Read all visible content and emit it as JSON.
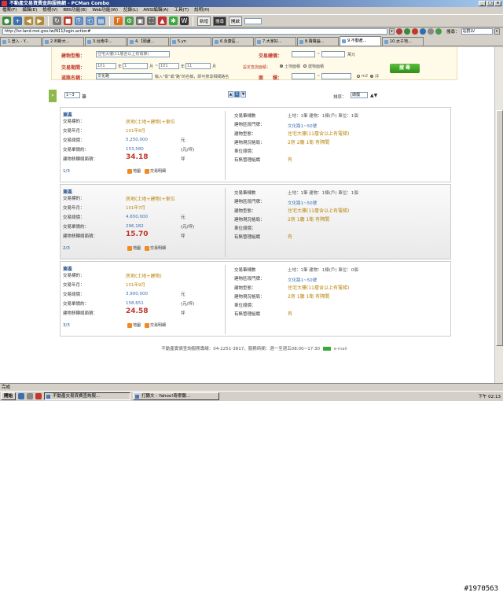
{
  "window": {
    "title": "不動產交易資費查詢服務網 - PCMan Combo",
    "menu": [
      "檔案(F)",
      "編輯(E)",
      "檢視(V)",
      "BBS功能(B)",
      "Web功能(W)",
      "記錄(L)",
      "ANSI編輯(A)",
      "工具(T)",
      "說明(H)"
    ]
  },
  "toolbar": {
    "label_a": "新增",
    "label_b": "搜尋",
    "label_c": "開啟"
  },
  "address": {
    "url": "http://lvr.land.moi.gov.tw/N11/login.action#",
    "search_label": "搜尋：",
    "search_value": "站群LV"
  },
  "tabs": [
    {
      "label": "1.登入 - Y..."
    },
    {
      "label": "2.判斷大..."
    },
    {
      "label": "3.台南中..."
    },
    {
      "label": "4.【頭蘆..."
    },
    {
      "label": "5.yn"
    },
    {
      "label": "6.永康區..."
    },
    {
      "label": "7.大家好..."
    },
    {
      "label": "8.聲聲論..."
    },
    {
      "label": "9.不動產..."
    },
    {
      "label": "10.太子地..."
    }
  ],
  "filters": {
    "building_type_label": "建物型態：",
    "building_type_value": "住宅大樓(11層含以上有電梯)",
    "total_price_label": "交易總價：",
    "total_price_unit": "萬元",
    "period_label": "交易期間：",
    "year_from": "101",
    "year_unit": "年",
    "month_from": "1",
    "month_unit": "月",
    "year_to": "101",
    "month_to": "11",
    "area_setting_label": "設定查詢面積：",
    "radio_land": "土地面積",
    "radio_building": "建物面積",
    "road_label": "道路名稱：",
    "road_value": "文化路",
    "road_hint": "輸入\"街\"或\"路\"的名稱，即可搜尋相關路名",
    "area_label": "面　　積：",
    "unit_m2": "m2",
    "unit_ping": "坪",
    "search_button": "搜 尋"
  },
  "pager": {
    "side_tab": "»",
    "range_select": "1~3",
    "range_unit": "筆",
    "prev": "▲",
    "current_page": "1",
    "next": "▼",
    "sort_label": "排序：",
    "sort_value": "總價",
    "sort_arrows": "▲▼"
  },
  "labels": {
    "trade_date": "交易標的：",
    "trade_ym": "交易年月：",
    "total_price": "交易總價：",
    "unit_price": "交易單價約：",
    "converted_area": "建物移轉總面積：",
    "trade_count": "交易筆棟數",
    "address": "建物區段門牌：",
    "building_type": "建物型態：",
    "layout": "建物現況格局：",
    "parking": "車位總價：",
    "management": "有無管理組織",
    "map_link": "地圖",
    "detail_link": "交易明細",
    "unit_yuan": "元",
    "unit_yuan_ping": "(元/坪)",
    "unit_ping": "坪"
  },
  "listings": [
    {
      "district": "東區",
      "type": "房地(土地+建物)+車位",
      "date": "101年8月",
      "total": "5,250,000",
      "unit_price": "153,580",
      "area": "34.18",
      "index": "1/3",
      "count": "土地：1筆 建物：1棟(戶) 車位：1個",
      "address": "文化路1~50號",
      "building": "住宅大樓(11層含以上有電梯)",
      "layout": "2房 2廳 1衛 有隔間",
      "parking": "",
      "management": "有"
    },
    {
      "district": "東區",
      "type": "房地(土地+建物)+車位",
      "date": "101年7月",
      "total": "4,650,000",
      "unit_price": "296,182",
      "area": "15.70",
      "index": "2/3",
      "count": "土地：1筆 建物：1棟(戶) 車位：1個",
      "address": "文化路1~50號",
      "building": "住宅大樓(11層含以上有電梯)",
      "layout": "2房 1廳 1衛 有隔間",
      "parking": "",
      "management": "有"
    },
    {
      "district": "東區",
      "type": "房地(土地+建物)",
      "date": "101年9月",
      "total": "3,900,000",
      "unit_price": "158,651",
      "area": "24.58",
      "index": "3/3",
      "count": "土地：1筆 建物：1棟(戶) 車位：0個",
      "address": "文化路1~50號",
      "building": "住宅大樓(11層含以上有電梯)",
      "layout": "2房 1廳 1衛 有隔間",
      "parking": "",
      "management": "有"
    }
  ],
  "footer": {
    "text": "不動產實價查詢服務專線：04-2251-3817，服務時間：週一至週五08:00~17:30",
    "email": "e-mail"
  },
  "status": {
    "text": "完成"
  },
  "taskbar": {
    "start": "開始",
    "task1": "不動產交易資費查詢服...",
    "task2": "打聽文 - Yahoo!奇摩聽...",
    "clock": "下午 02:13"
  },
  "watermark": "#1970563"
}
